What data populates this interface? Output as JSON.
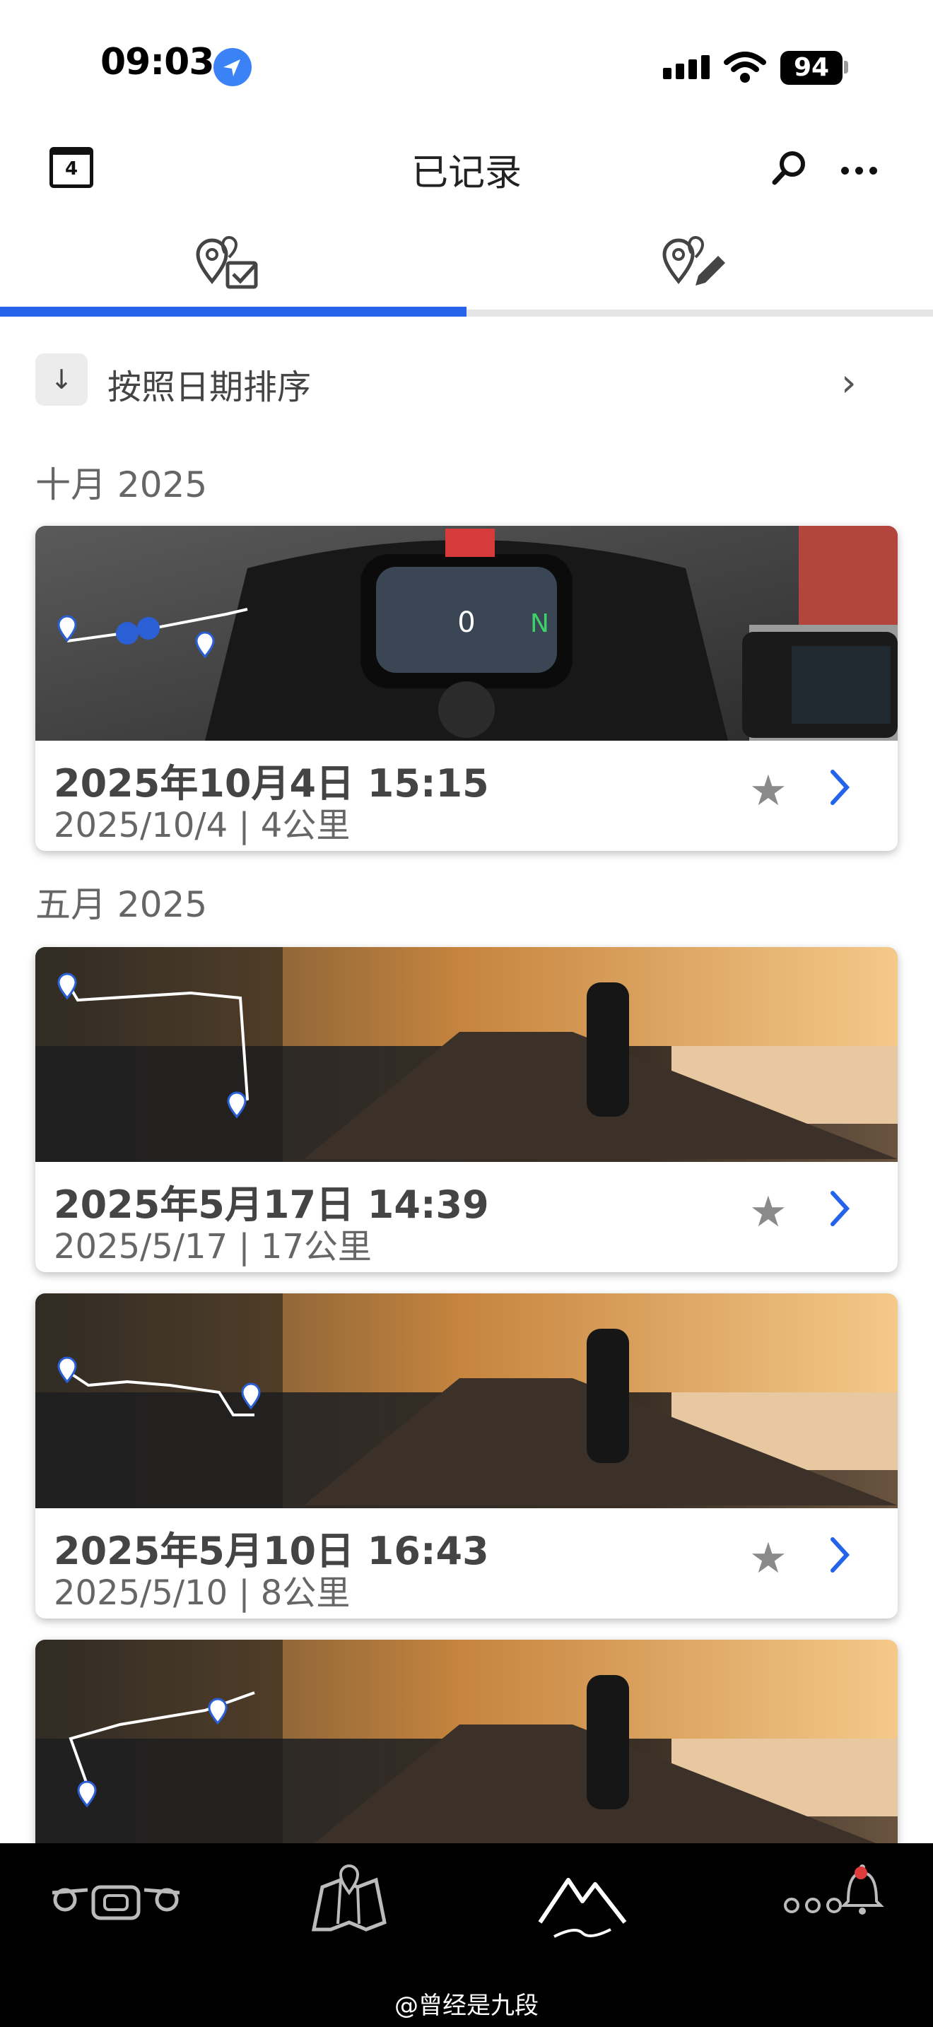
{
  "status_bar": {
    "time": "09:03",
    "battery": "94"
  },
  "header": {
    "calendar_day": "4",
    "title": "已记录"
  },
  "tabs": [
    {
      "name": "recorded",
      "active": true
    },
    {
      "name": "planned",
      "active": false
    }
  ],
  "sort": {
    "label": "按照日期排序"
  },
  "sections": [
    {
      "month": "十月 2025",
      "rides": [
        {
          "title": "2025年10月4日 15:15",
          "subtitle": "2025/10/4 | 4公里"
        }
      ]
    },
    {
      "month": "五月 2025",
      "rides": [
        {
          "title": "2025年5月17日 14:39",
          "subtitle": "2025/5/17 | 17公里"
        },
        {
          "title": "2025年5月10日 16:43",
          "subtitle": "2025/5/10 | 8公里"
        }
      ]
    }
  ],
  "bottom_nav": [
    {
      "icon": "motorcycle-icon"
    },
    {
      "icon": "map-icon"
    },
    {
      "icon": "mountain-route-icon"
    },
    {
      "icon": "notifications-icon"
    }
  ],
  "watermark": "@曾经是九段",
  "colors": {
    "accent": "#2563eb",
    "nav_bg": "#000000",
    "star": "#8a8a8a"
  }
}
